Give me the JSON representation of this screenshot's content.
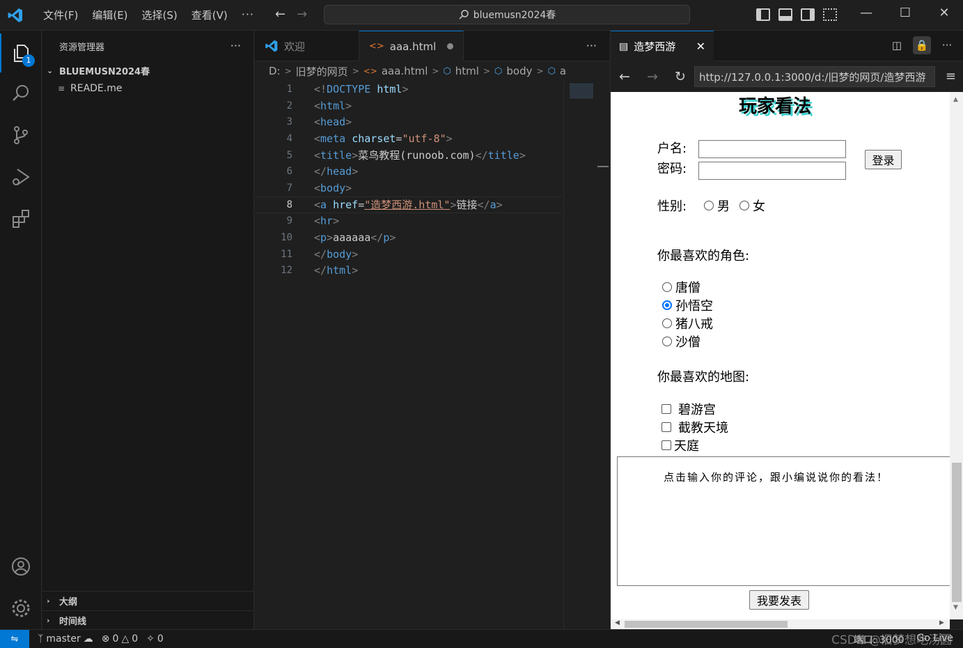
{
  "titlebar": {
    "menu": [
      "文件(F)",
      "编辑(E)",
      "选择(S)",
      "查看(V)"
    ],
    "more": "···",
    "search_text": "bluemusn2024春",
    "back_arrow": "←",
    "forward_arrow": "→",
    "minimize": "—",
    "maximize": "☐",
    "close": "✕"
  },
  "activity_bar": {
    "explorer_badge": "1",
    "icons": [
      "explorer-icon",
      "search-icon",
      "source-control-icon",
      "run-debug-icon",
      "extensions-icon",
      "account-icon",
      "settings-gear-icon"
    ]
  },
  "sidebar": {
    "title": "资源管理器",
    "more": "···",
    "root_folder": "BLUEMUSN2024春",
    "files": [
      "READE.me"
    ],
    "outline": "大纲",
    "timeline": "时间线"
  },
  "editor": {
    "tabs": [
      {
        "label": "欢迎",
        "active": false
      },
      {
        "label": "aaa.html",
        "active": true,
        "modified": true
      }
    ],
    "more": "···",
    "breadcrumb": [
      "D:",
      "旧梦的网页",
      "aaa.html",
      "html",
      "body",
      "a"
    ],
    "current_line": 8,
    "lines": [
      {
        "n": "1",
        "parts": [
          [
            "tg",
            "<!"
          ],
          [
            "tn",
            "DOCTYPE"
          ],
          [
            "tx",
            " "
          ],
          [
            "an",
            "html"
          ],
          [
            "tg",
            ">"
          ]
        ]
      },
      {
        "n": "2",
        "parts": [
          [
            "tg",
            "<"
          ],
          [
            "tn",
            "html"
          ],
          [
            "tg",
            ">"
          ]
        ]
      },
      {
        "n": "3",
        "parts": [
          [
            "tg",
            "<"
          ],
          [
            "tn",
            "head"
          ],
          [
            "tg",
            ">"
          ]
        ]
      },
      {
        "n": "4",
        "parts": [
          [
            "tg",
            "<"
          ],
          [
            "tn",
            "meta"
          ],
          [
            "tx",
            " "
          ],
          [
            "an",
            "charset"
          ],
          [
            "tx",
            "="
          ],
          [
            "av",
            "\"utf-8\""
          ],
          [
            "tg",
            ">"
          ]
        ]
      },
      {
        "n": "5",
        "parts": [
          [
            "tg",
            "<"
          ],
          [
            "tn",
            "title"
          ],
          [
            "tg",
            ">"
          ],
          [
            "tx",
            "菜鸟教程(runoob.com)"
          ],
          [
            "tg",
            "</"
          ],
          [
            "tn",
            "title"
          ],
          [
            "tg",
            ">"
          ]
        ]
      },
      {
        "n": "6",
        "parts": [
          [
            "tg",
            "</"
          ],
          [
            "tn",
            "head"
          ],
          [
            "tg",
            ">"
          ]
        ]
      },
      {
        "n": "7",
        "parts": [
          [
            "tg",
            "<"
          ],
          [
            "tn",
            "body"
          ],
          [
            "tg",
            ">"
          ]
        ]
      },
      {
        "n": "8",
        "parts": [
          [
            "tg",
            "<"
          ],
          [
            "tn",
            "a"
          ],
          [
            "tx",
            " "
          ],
          [
            "an",
            "href"
          ],
          [
            "tx",
            "="
          ],
          [
            "av",
            "\"造梦西游.html\""
          ],
          [
            "tg",
            ">"
          ],
          [
            "tx",
            "链接"
          ],
          [
            "tg",
            "</"
          ],
          [
            "tn",
            "a"
          ],
          [
            "tg",
            ">"
          ]
        ]
      },
      {
        "n": "9",
        "parts": [
          [
            "tg",
            "<"
          ],
          [
            "tn",
            "hr"
          ],
          [
            "tg",
            ">"
          ]
        ]
      },
      {
        "n": "10",
        "parts": [
          [
            "tg",
            "<"
          ],
          [
            "tn",
            "p"
          ],
          [
            "tg",
            ">"
          ],
          [
            "tx",
            "aaaaaa"
          ],
          [
            "tg",
            "</"
          ],
          [
            "tn",
            "p"
          ],
          [
            "tg",
            ">"
          ]
        ]
      },
      {
        "n": "11",
        "parts": [
          [
            "tg",
            "</"
          ],
          [
            "tn",
            "body"
          ],
          [
            "tg",
            ">"
          ]
        ]
      },
      {
        "n": "12",
        "parts": [
          [
            "tg",
            "</"
          ],
          [
            "tn",
            "html"
          ],
          [
            "tg",
            ">"
          ]
        ]
      }
    ]
  },
  "browser": {
    "tab_title": "造梦西游",
    "close": "✕",
    "url": "http://127.0.0.1:3000/d:/旧梦的网页/造梦西游",
    "page": {
      "title": "玩家看法",
      "username_label": "户名:",
      "password_label": "密码:",
      "login_button": "登录",
      "gender_label": "性别:",
      "gender_options": [
        "男",
        "女"
      ],
      "role_question": "你最喜欢的角色:",
      "roles": [
        "唐僧",
        "孙悟空",
        "猪八戒",
        "沙僧"
      ],
      "selected_role": "孙悟空",
      "map_question": "你最喜欢的地图:",
      "maps": [
        "碧游宫",
        "截教天境",
        "天庭"
      ],
      "comment_placeholder": "点击输入你的评论，跟小编说说你的看法！",
      "submit_button": "我要发表"
    }
  },
  "statusbar": {
    "branch": "master",
    "errors": "0",
    "warnings": "0",
    "ports": "0",
    "port_info": "端口: 3000",
    "golive": "Go Live",
    "watermark": "CSDN @旧梦想吃汤圆"
  }
}
